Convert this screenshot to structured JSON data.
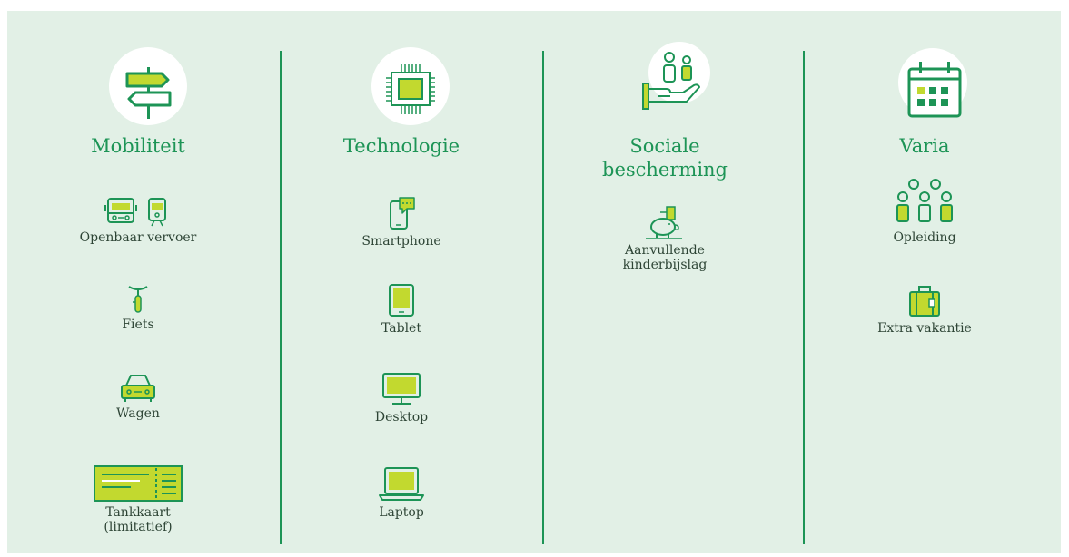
{
  "colors": {
    "green": "#1d9456",
    "lime": "#c2d92f",
    "panel": "#e2f0e6",
    "text": "#2d4435"
  },
  "columns": [
    {
      "title": "Mobiliteit",
      "icon": "signpost-icon",
      "items": [
        {
          "label": "Openbaar vervoer",
          "icon": "bus-train-icon"
        },
        {
          "label": "Fiets",
          "icon": "bicycle-icon"
        },
        {
          "label": "Wagen",
          "icon": "car-icon"
        },
        {
          "label": "Tankkaart\n(limitatief)",
          "icon": "fuel-card-icon"
        }
      ]
    },
    {
      "title": "Technologie",
      "icon": "chip-icon",
      "items": [
        {
          "label": "Smartphone",
          "icon": "smartphone-icon"
        },
        {
          "label": "Tablet",
          "icon": "tablet-icon"
        },
        {
          "label": "Desktop",
          "icon": "desktop-icon"
        },
        {
          "label": "Laptop",
          "icon": "laptop-icon"
        }
      ]
    },
    {
      "title": "Sociale\nbescherming",
      "icon": "family-hand-icon",
      "items": [
        {
          "label": "Aanvullende\nkinderbijslag",
          "icon": "piggy-bank-icon"
        }
      ]
    },
    {
      "title": "Varia",
      "icon": "calendar-icon",
      "items": [
        {
          "label": "Opleiding",
          "icon": "group-icon"
        },
        {
          "label": "Extra vakantie",
          "icon": "suitcase-icon"
        }
      ]
    }
  ]
}
